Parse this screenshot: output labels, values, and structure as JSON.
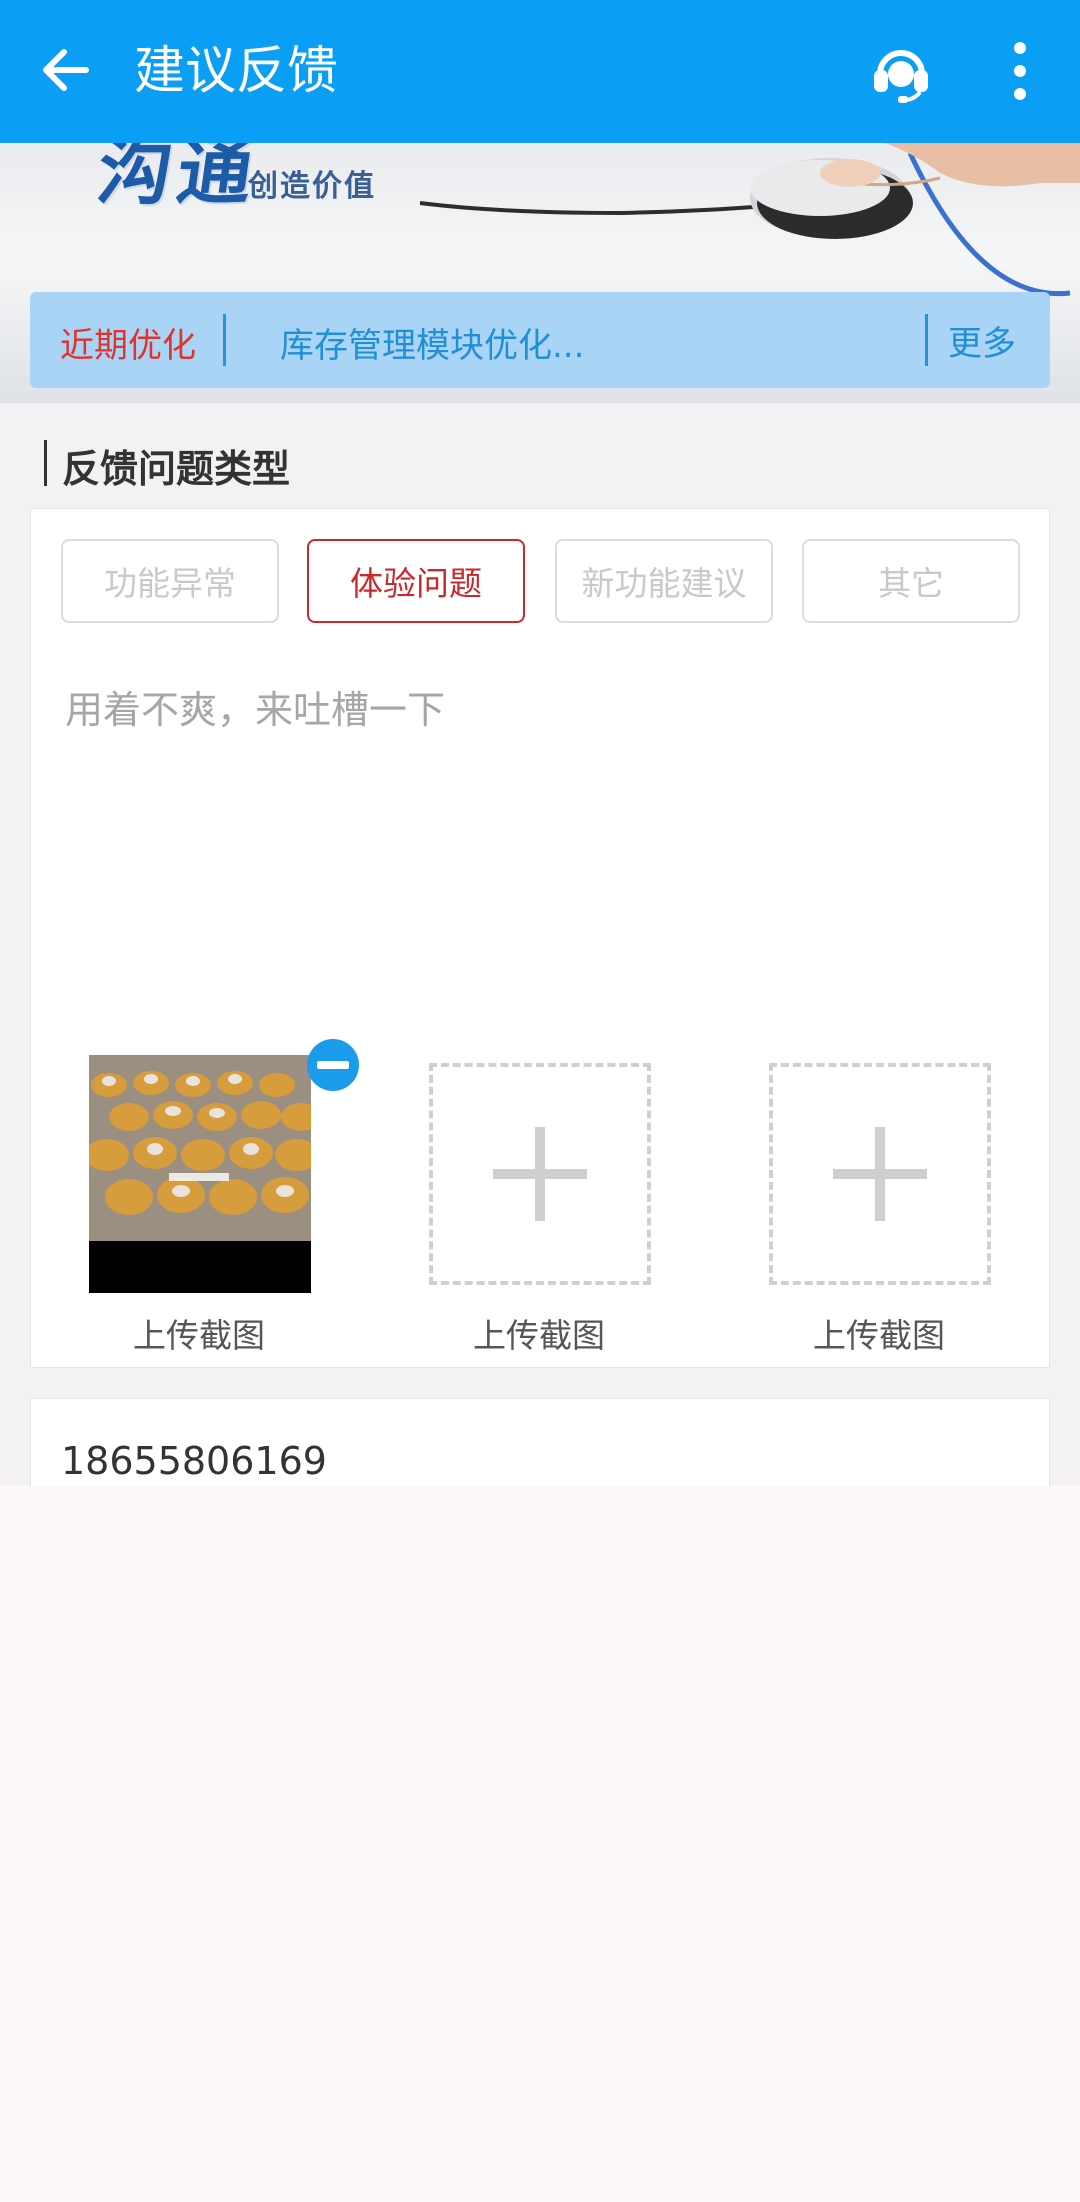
{
  "appbar": {
    "title": "建议反馈",
    "bg_color": "#0b9ef5",
    "back_icon": "arrow-left-icon",
    "service_icon": "headset-icon",
    "more_icon": "more-vertical-icon"
  },
  "banner": {
    "logo_text": "沟通",
    "slogan": "创造价值"
  },
  "notice": {
    "tag": "近期优化",
    "message": "库存管理模块优化...",
    "more": "更多"
  },
  "section": {
    "title": "反馈问题类型"
  },
  "feedback_types": [
    {
      "label": "功能异常",
      "selected": false
    },
    {
      "label": "体验问题",
      "selected": true
    },
    {
      "label": "新功能建议",
      "selected": false
    },
    {
      "label": "其它",
      "selected": false
    }
  ],
  "feedback_input": {
    "value": "",
    "placeholder": "用着不爽，来吐槽一下"
  },
  "uploads": [
    {
      "label": "上传截图",
      "filled": true
    },
    {
      "label": "上传截图",
      "filled": false
    },
    {
      "label": "上传截图",
      "filled": false
    }
  ],
  "contact": {
    "value": "18655806169"
  },
  "colors": {
    "accent": "#0b9ef5",
    "selected": "#c9282d",
    "notice_tag": "#e0332e",
    "notice_text": "#1f8fd6"
  }
}
